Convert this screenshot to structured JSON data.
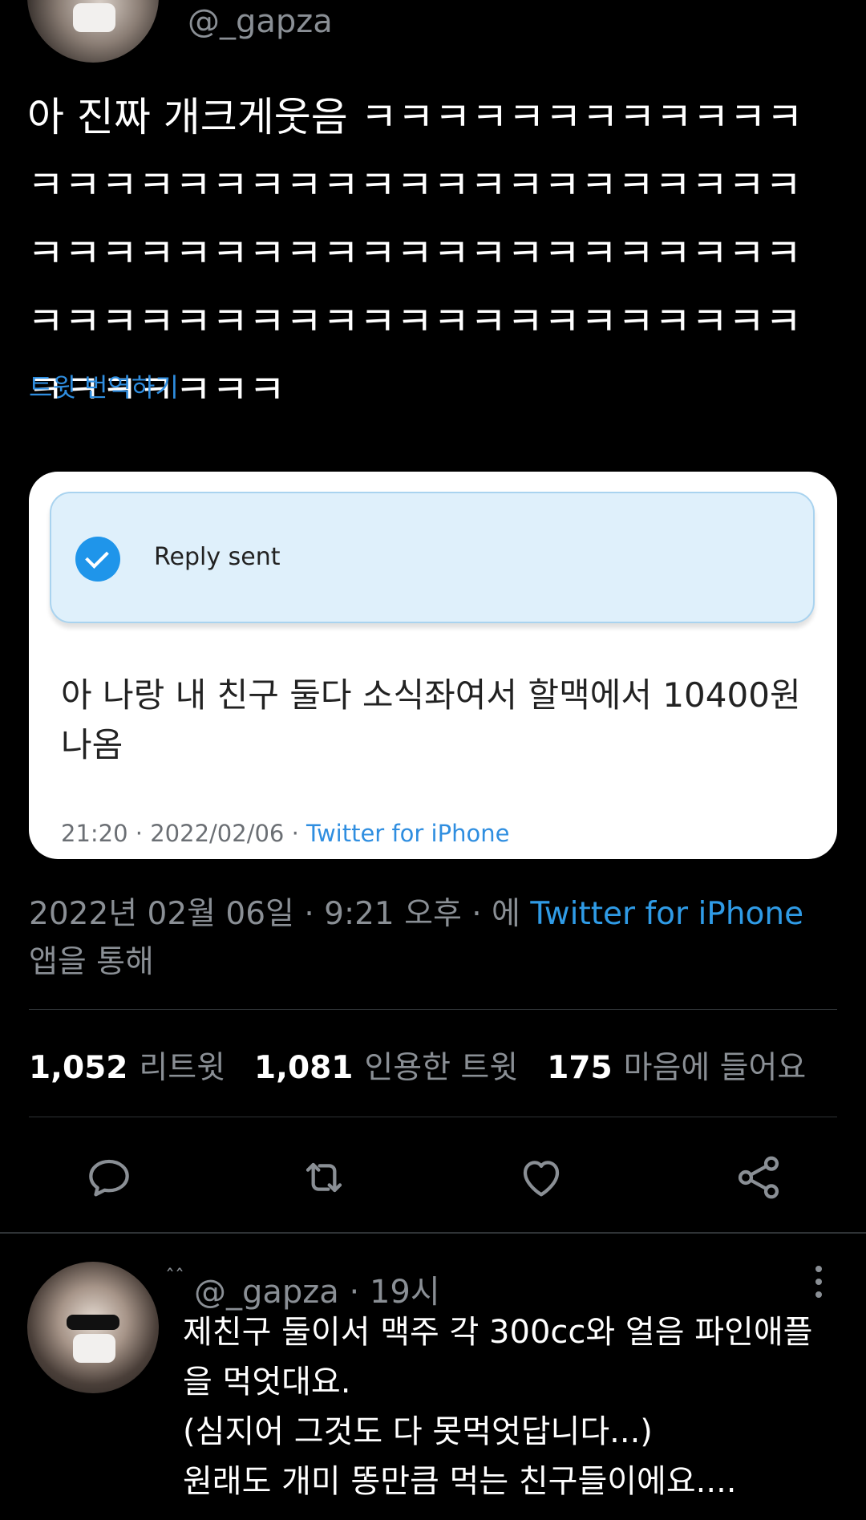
{
  "tweet": {
    "handle": "@_gapza",
    "text": "아 진짜 개크게웃음 ㅋㅋㅋㅋㅋㅋㅋㅋㅋㅋㅋㅋㅋㅋㅋㅋㅋㅋㅋㅋㅋㅋㅋㅋㅋㅋㅋㅋㅋㅋㅋㅋㅋㅋㅋㅋㅋㅋㅋㅋㅋㅋㅋㅋㅋㅋㅋㅋㅋㅋㅋㅋㅋㅋㅋㅋㅋㅋㅋㅋㅋㅋㅋㅋㅋㅋㅋㅋㅋㅋㅋㅋㅋㅋㅋㅋㅋㅋㅋㅋㅋㅋ",
    "translate_label": "트윗 번역하기",
    "timestamp_prefix": "2022년 02월 06일 · 9:21 오후 · 에 ",
    "timestamp_source": "Twitter for iPhone",
    "timestamp_suffix": "앱을 통해",
    "icons": [
      "reply-icon",
      "retweet-icon",
      "like-icon",
      "share-icon"
    ]
  },
  "card": {
    "toast_label": "Reply sent",
    "body_text": "아 나랑 내 친구 둘다 소식좌여서 할맥에서 10400원 나옴",
    "meta_time": "21:20 · 2022/02/06 · ",
    "meta_source": "Twitter for iPhone"
  },
  "stats": {
    "retweets_count": "1,052",
    "retweets_label": "리트윗",
    "quotes_count": "1,081",
    "quotes_label": "인용한 트윗",
    "likes_count": "175",
    "likes_label": "마음에 들어요"
  },
  "reply": {
    "decoration": "ˆˆ",
    "handle": "@_gapza · 19시",
    "text": "제친구 둘이서 맥주 각 300cc와 얼음 파인애플을 먹엇대요.\n(심지어 그것도 다 못먹엇답니다...)\n원래도 개미 똥만큼 먹는 친구들이에요...."
  },
  "colors": {
    "background": "#000000",
    "link": "#2f8ee0",
    "muted": "#8a8f95",
    "toast_bg": "#dff0fb",
    "check": "#1f95ea"
  }
}
